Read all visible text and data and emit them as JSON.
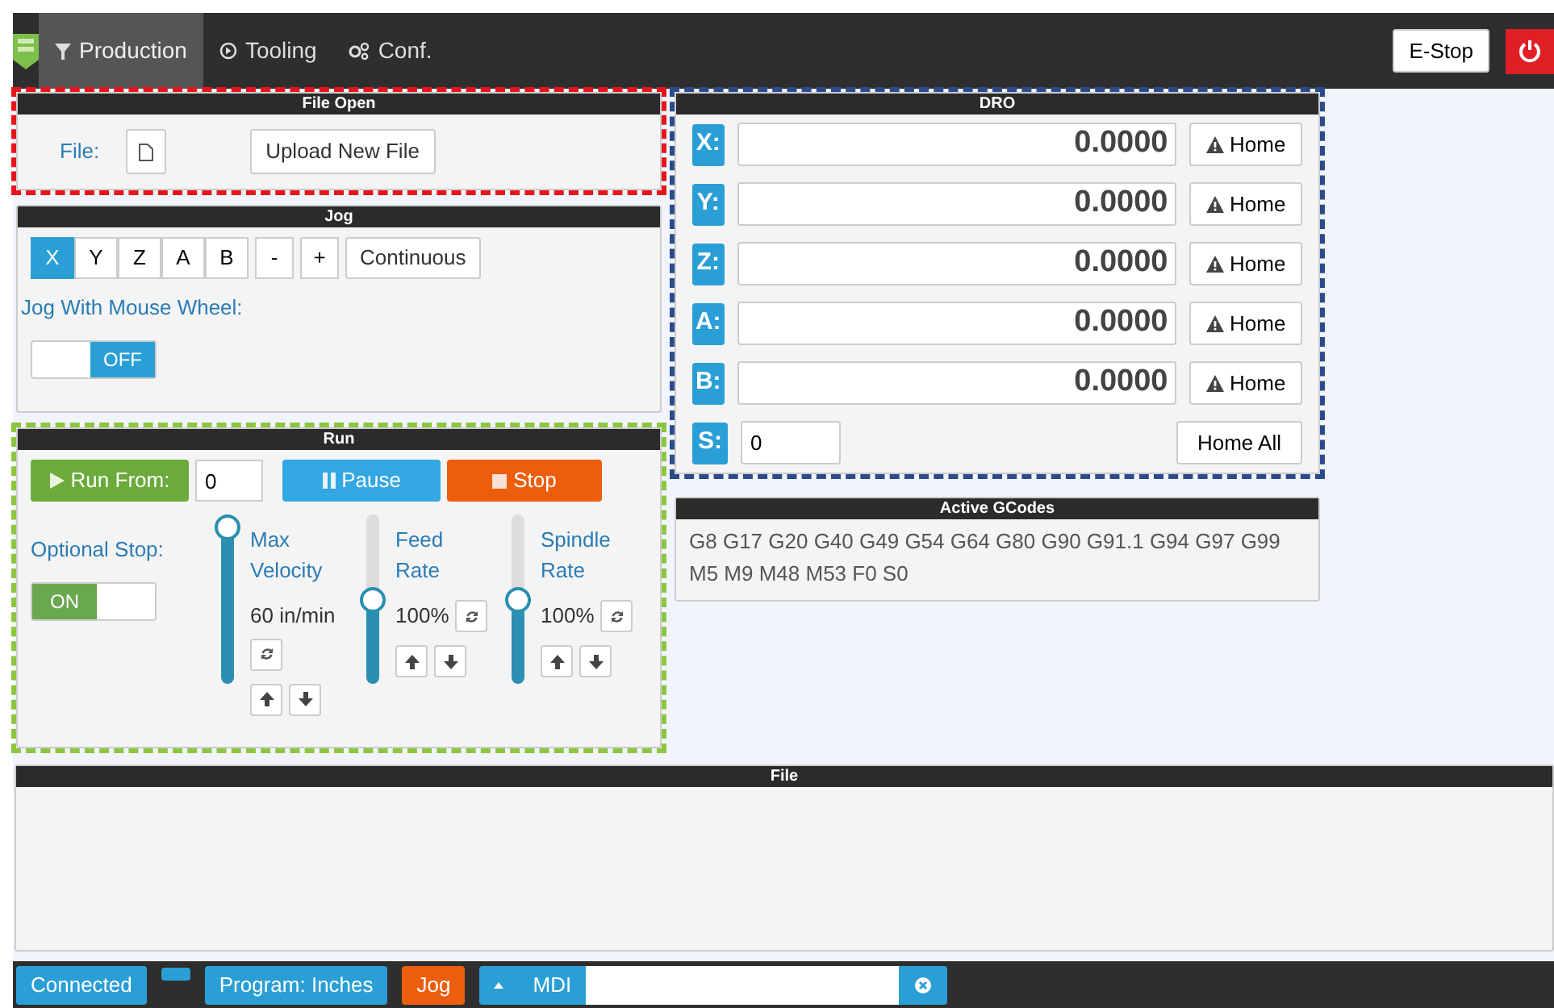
{
  "nav": {
    "tabs": [
      {
        "label": "Production",
        "selected": true
      },
      {
        "label": "Tooling",
        "selected": false
      },
      {
        "label": "Conf.",
        "selected": false
      }
    ],
    "estop": "E-Stop"
  },
  "file_open": {
    "title": "File Open",
    "outline": {
      "color": "#e8141c"
    },
    "label": "File:",
    "upload": "Upload New File"
  },
  "jog": {
    "title": "Jog",
    "axes": [
      {
        "label": "X",
        "selected": true
      },
      {
        "label": "Y",
        "selected": false
      },
      {
        "label": "Z",
        "selected": false
      },
      {
        "label": "A",
        "selected": false
      },
      {
        "label": "B",
        "selected": false
      }
    ],
    "steps": [
      "-",
      "+"
    ],
    "mode": "Continuous",
    "wheel_label": "Jog With Mouse Wheel:",
    "wheel_switch": {
      "on": false,
      "label": "OFF"
    }
  },
  "run": {
    "title": "Run",
    "outline": {
      "color": "#8cc63f"
    },
    "run_from": "Run From:",
    "line": "0",
    "pause": "Pause",
    "stop": "Stop",
    "optional_stop": "Optional Stop:",
    "optional_switch": {
      "on": true,
      "label": "ON"
    },
    "sliders": [
      {
        "label": "Max Velocity",
        "level": 1,
        "reading": "60 in/min"
      },
      {
        "label": "Feed Rate",
        "level": 0.5,
        "reading": "100%"
      },
      {
        "label": "Spindle Rate",
        "level": 0.5,
        "reading": "100%"
      }
    ]
  },
  "dro": {
    "title": "DRO",
    "outline": {
      "color": "#2b4b8c"
    },
    "axes": [
      {
        "label": "X:",
        "value": "0.0000",
        "home": "Home"
      },
      {
        "label": "Y:",
        "value": "0.0000",
        "home": "Home"
      },
      {
        "label": "Z:",
        "value": "0.0000",
        "home": "Home"
      },
      {
        "label": "A:",
        "value": "0.0000",
        "home": "Home"
      },
      {
        "label": "B:",
        "value": "0.0000",
        "home": "Home"
      }
    ],
    "spindle": {
      "label": "S:",
      "value": "0",
      "home_all": "Home All"
    }
  },
  "gcodes": {
    "title": "Active GCodes",
    "text": "G8 G17 G20 G40 G49 G54 G64 G80 G90 G91.1 G94 G97 G99 M5 M9 M48 M53 F0 S0"
  },
  "file": {
    "title": "File"
  },
  "status_bar": {
    "connected": "Connected",
    "program": "Program: Inches",
    "jog": "Jog",
    "mdi": "MDI"
  }
}
